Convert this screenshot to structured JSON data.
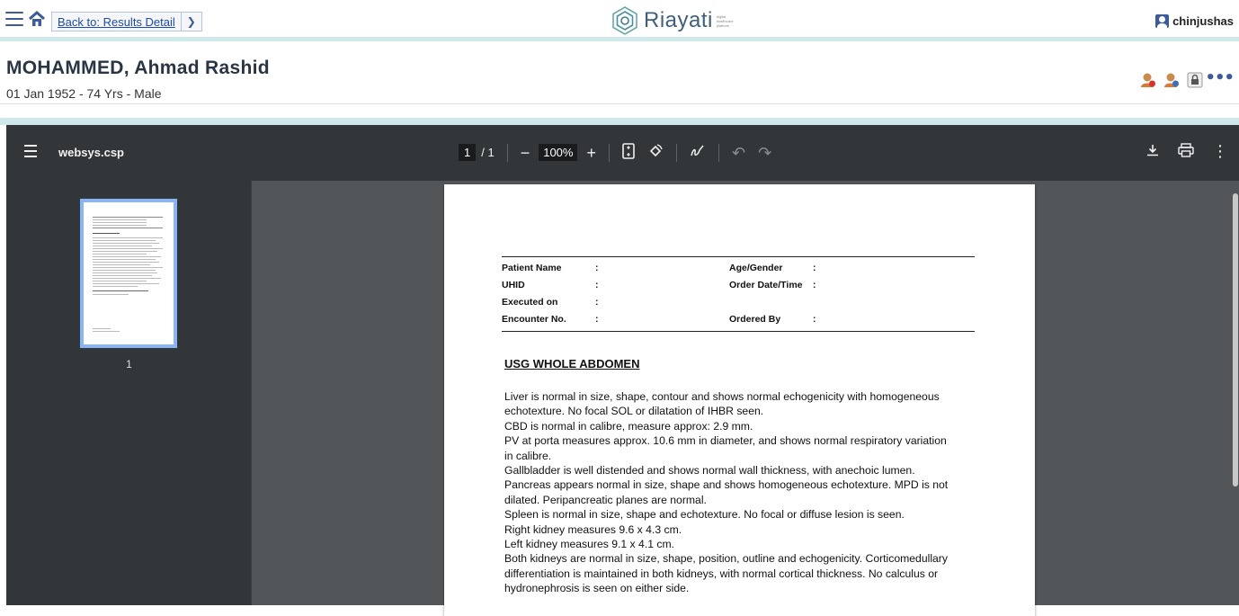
{
  "topbar": {
    "back_label": "Back to: Results Detail",
    "brand": "Riayati",
    "brand_tag": "digital healthcare platform",
    "username": "chinjushas"
  },
  "patient": {
    "name": "MOHAMMED, Ahmad Rashid",
    "info": "01 Jan 1952 - 74 Yrs - Male",
    "more": "•••"
  },
  "viewer": {
    "title": "websys.csp",
    "page_current": "1",
    "page_total": "/ 1",
    "zoom": "100%",
    "thumb_label": "1"
  },
  "report": {
    "header_rows": [
      {
        "l1": "Patient Name",
        "c1": ":",
        "l2": "Age/Gender",
        "c2": ":"
      },
      {
        "l1": "UHID",
        "c1": ":",
        "l2": "Order Date/Time",
        "c2": ":"
      },
      {
        "l1": "Executed on",
        "c1": ":",
        "l2": "",
        "c2": ""
      },
      {
        "l1": "Encounter No.",
        "c1": ":",
        "l2": "Ordered By",
        "c2": ":"
      }
    ],
    "title": "USG WHOLE ABDOMEN",
    "lines": [
      "Liver is normal in size, shape, contour and shows normal echogenicity with homogeneous",
      "echotexture. No focal SOL or dilatation of IHBR seen.",
      "CBD is normal in calibre, measure approx: 2.9 mm.",
      "PV at porta measures approx. 10.6 mm in diameter, and shows normal respiratory variation",
      "in calibre.",
      "Gallbladder is well distended and shows normal wall thickness, with anechoic lumen.",
      "Pancreas appears normal in size, shape and shows homogeneous echotexture. MPD is not",
      "dilated. Peripancreatic planes are normal.",
      "Spleen is normal in size, shape and echotexture. No focal or diffuse lesion is seen.",
      "Right kidney measures 9.6 x 4.3 cm.",
      "Left kidney measures 9.1 x 4.1 cm.",
      "Both kidneys are normal in size, shape, position, outline and echogenicity. Corticomedullary",
      "differentiation is maintained in both kidneys, with normal cortical thickness. No calculus or",
      "hydronephrosis is seen on either side."
    ]
  },
  "colors": {
    "accent": "#3d5a99",
    "strip": "#cfe9ea",
    "viewer_bg": "#525659",
    "toolbar_bg": "#323639"
  }
}
